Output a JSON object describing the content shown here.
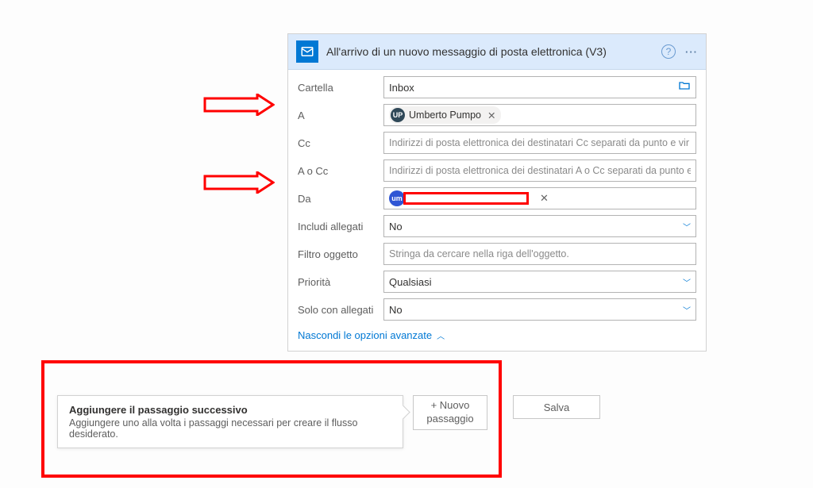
{
  "card": {
    "title": "All'arrivo di un nuovo messaggio di posta elettronica (V3)",
    "fields": {
      "cartella": {
        "label": "Cartella",
        "value": "Inbox"
      },
      "a": {
        "label": "A",
        "chip_initials": "UP",
        "chip_name": "Umberto Pumpo"
      },
      "cc": {
        "label": "Cc",
        "placeholder": "Indirizzi di posta elettronica dei destinatari Cc separati da punto e vir"
      },
      "a_o_cc": {
        "label": "A o Cc",
        "placeholder": "Indirizzi di posta elettronica dei destinatari A o Cc separati da punto e"
      },
      "da": {
        "label": "Da",
        "chip_initials": "um"
      },
      "includi_allegati": {
        "label": "Includi allegati",
        "value": "No"
      },
      "filtro_oggetto": {
        "label": "Filtro oggetto",
        "placeholder": "Stringa da cercare nella riga dell'oggetto."
      },
      "priorita": {
        "label": "Priorità",
        "value": "Qualsiasi"
      },
      "solo_con_allegati": {
        "label": "Solo con allegati",
        "value": "No"
      }
    },
    "advanced_link": "Nascondi le opzioni avanzate"
  },
  "callout": {
    "title": "Aggiungere il passaggio successivo",
    "text": "Aggiungere uno alla volta i passaggi necessari per creare il flusso desiderato."
  },
  "buttons": {
    "new_step": "+ Nuovo passaggio",
    "save": "Salva"
  }
}
